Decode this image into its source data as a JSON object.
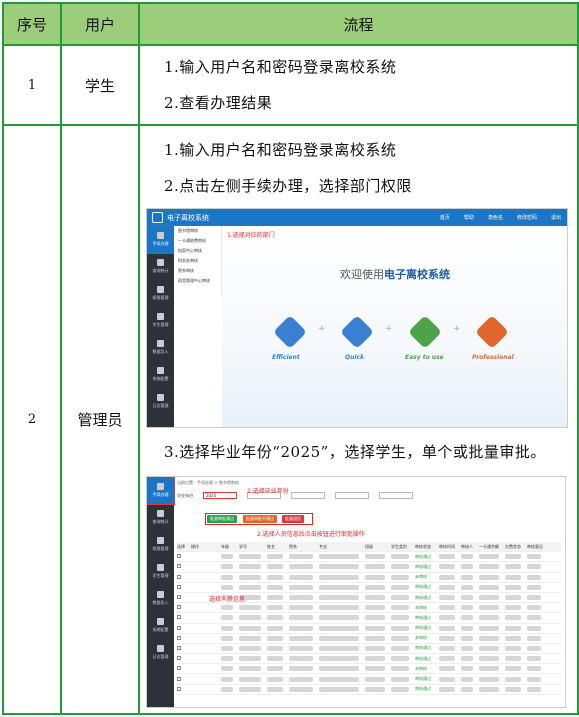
{
  "header": {
    "col_no": "序号",
    "col_user": "用户",
    "col_flow": "流程"
  },
  "rows": [
    {
      "no": "1",
      "user": "学生",
      "steps": [
        "1.输入用户名和密码登录离校系统",
        "2.查看办理结果"
      ]
    },
    {
      "no": "2",
      "user": "管理员",
      "steps": [
        "1.输入用户名和密码登录离校系统",
        "2.点击左侧手续办理，选择部门权限",
        "3.选择毕业年份“2025”，选择学生，单个或批量审批。"
      ]
    }
  ],
  "shot1": {
    "app_title": "电子离校系统",
    "top_menu": [
      "首页",
      "帮助",
      "角色名",
      "修改密码",
      "退出"
    ],
    "side_items": [
      "手续办理",
      "查询统计",
      "权限管理",
      "学生管理",
      "数据导入",
      "系统配置",
      "日志管理"
    ],
    "sub_menu": [
      "图书馆审核",
      "一卡通收费审核",
      "档案中心审核",
      "财务处审核",
      "院系审核",
      "宿舍管理中心审核"
    ],
    "note": "1.选择对应的部门",
    "welcome_prefix": "欢迎使用",
    "welcome_bold": "电子离校系统",
    "features": [
      {
        "name": "Efficient",
        "color": "#3b7fd3"
      },
      {
        "name": "Quick",
        "color": "#3b7fd3"
      },
      {
        "name": "Easy to use",
        "color": "#4ea34a"
      },
      {
        "name": "Professional",
        "color": "#e0662c"
      }
    ]
  },
  "shot2": {
    "breadcrumb": "当前位置：手续办理 > 图书馆审核",
    "year_label": "毕业年份",
    "year_value": "2025",
    "note_year": "2.选择毕业年份",
    "note_batch": "2.选择人员信息后点击按钮进行审批操作",
    "note_person": "选择人员信息",
    "buttons": [
      "批量审批通过",
      "批量审批不通过",
      "批量退回"
    ],
    "status_pass": "审核通过",
    "status_unpass": "未审核",
    "col_headers": [
      "选择",
      "操作",
      "年级",
      "学号",
      "姓名",
      "院系",
      "专业",
      "班级",
      "学生类别",
      "审核状态",
      "审核时间",
      "审核人",
      "一卡通余额",
      "欠费状态",
      "审核意见"
    ]
  }
}
